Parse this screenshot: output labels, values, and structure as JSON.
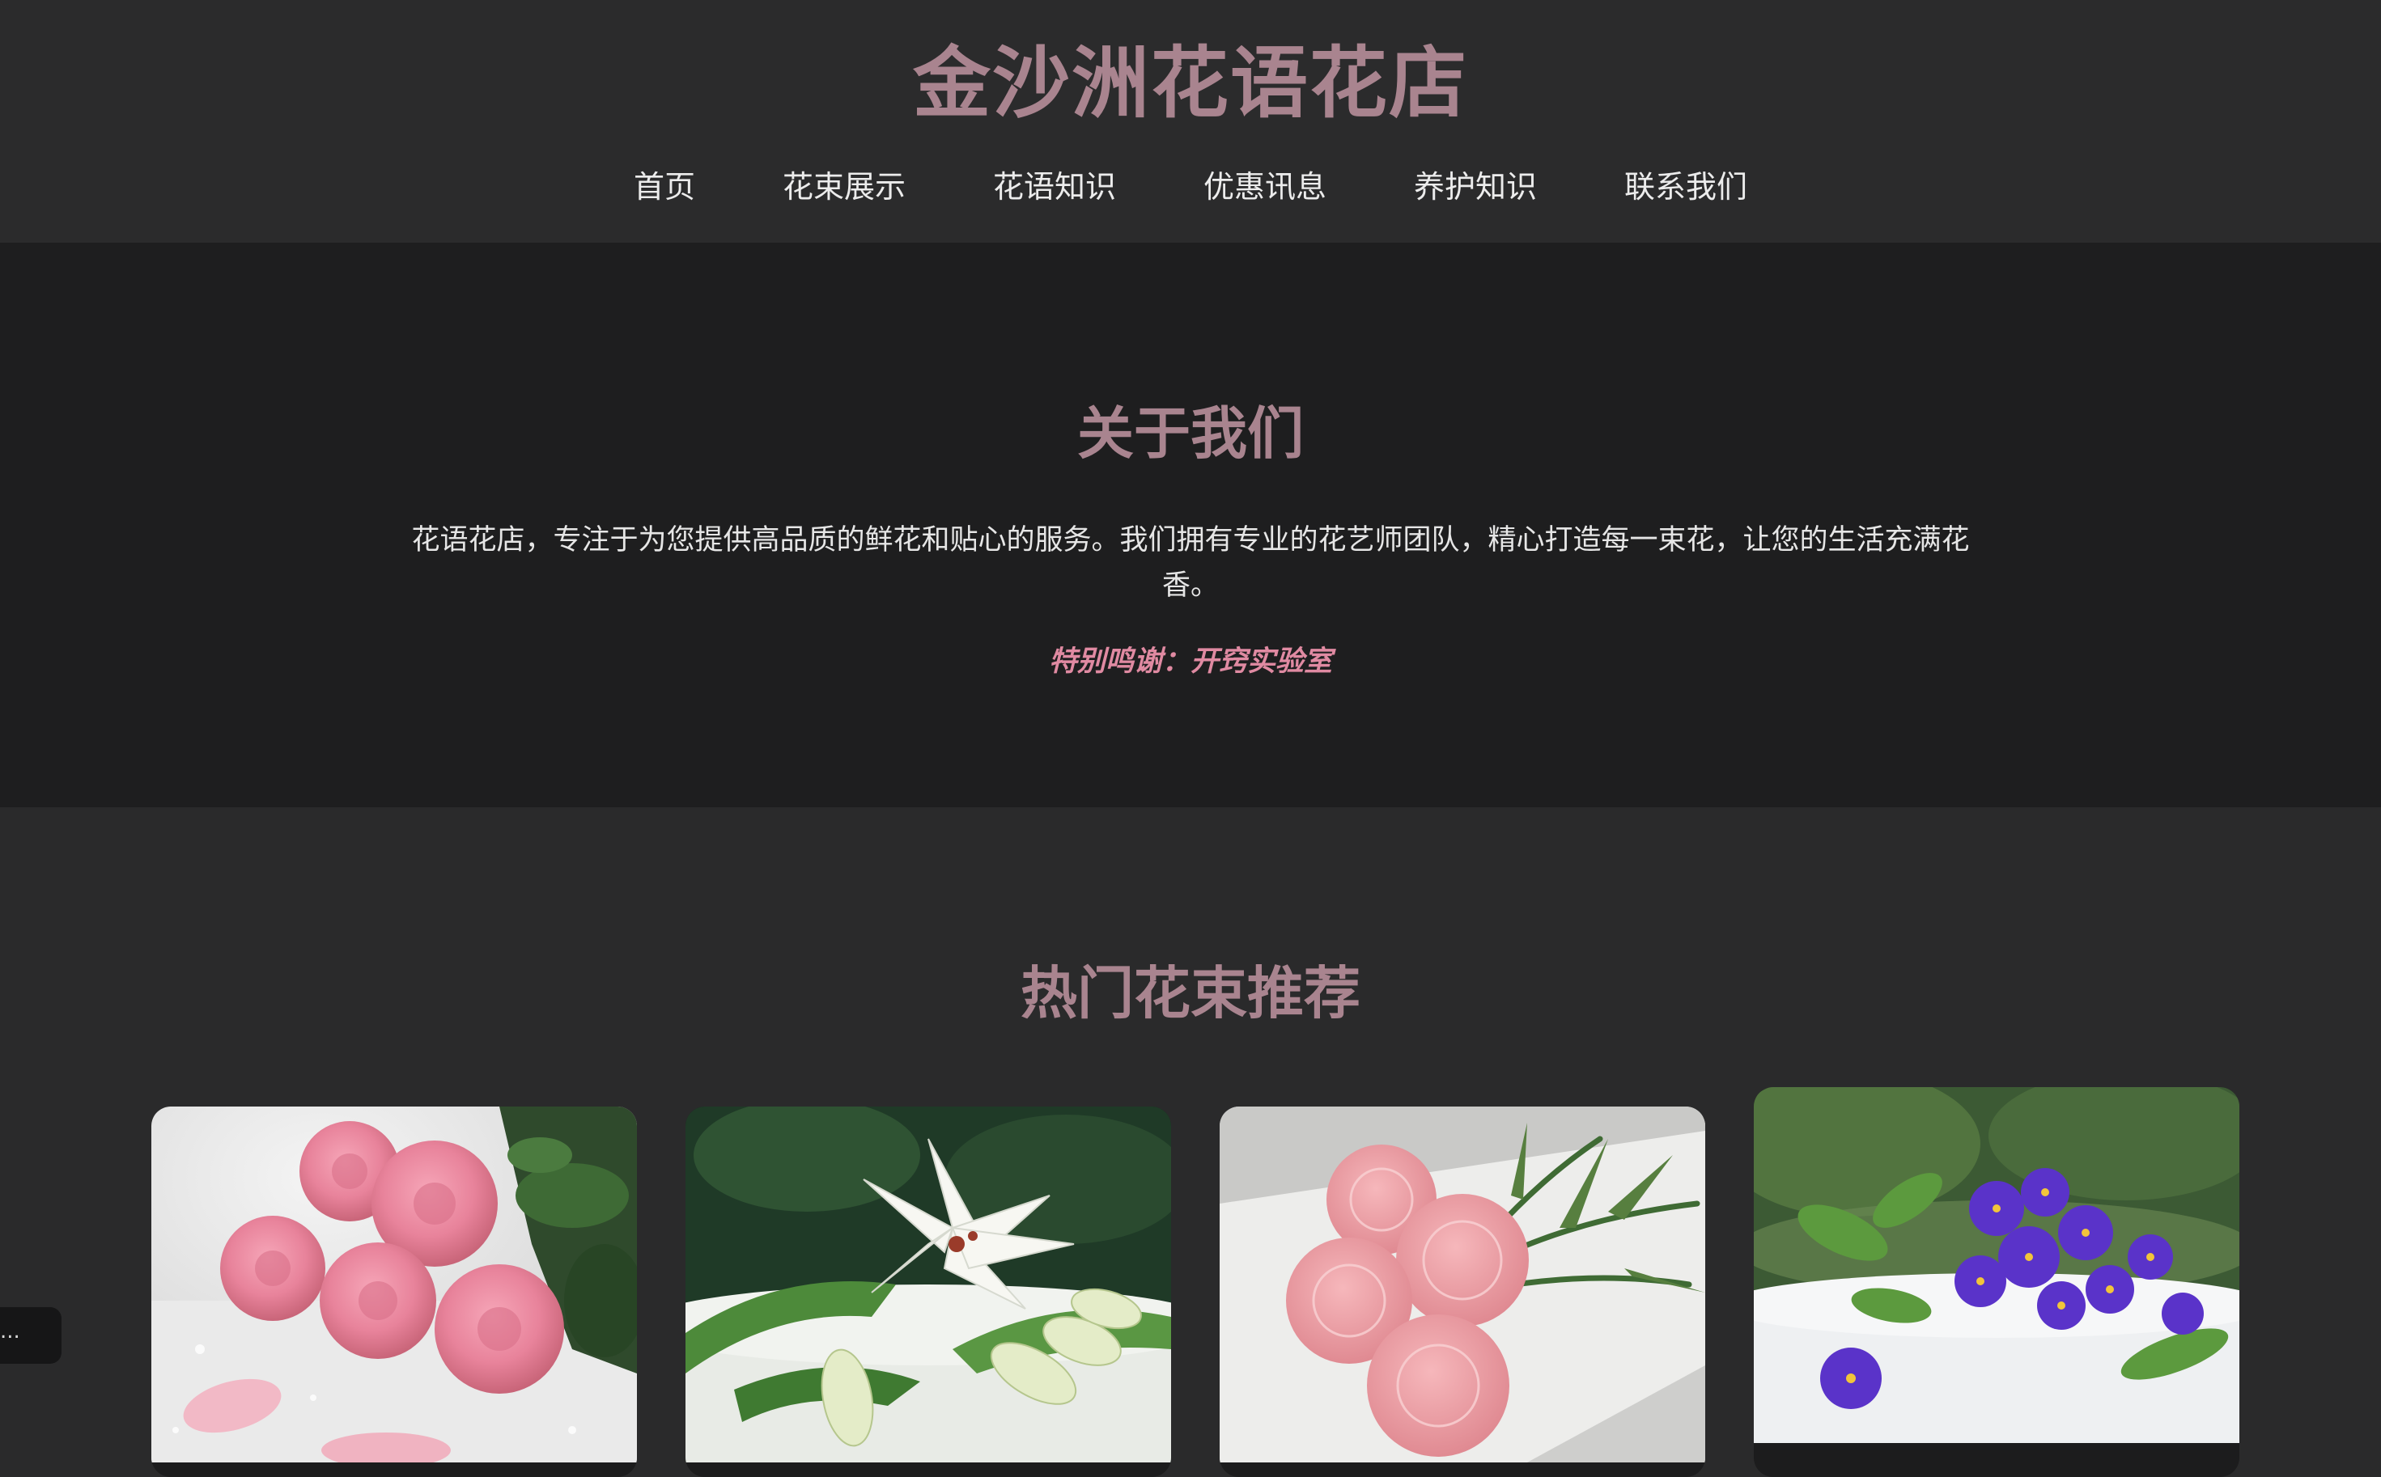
{
  "header": {
    "title": "金沙洲花语花店",
    "nav": [
      "首页",
      "花束展示",
      "花语知识",
      "优惠讯息",
      "养护知识",
      "联系我们"
    ]
  },
  "about": {
    "title": "关于我们",
    "description": "花语花店，专注于为您提供高品质的鲜花和贴心的服务。我们拥有专业的花艺师团队，精心打造每一束花，让您的生活充满花香。",
    "thanks": "特别鸣谢：开窍实验室"
  },
  "popular": {
    "title": "热门花束推荐",
    "cards": [
      {
        "alt": "pink roses"
      },
      {
        "alt": "white lilies"
      },
      {
        "alt": "pink carnations"
      },
      {
        "alt": "purple violets"
      }
    ]
  },
  "side_toast": {
    "text": "..."
  },
  "colors": {
    "accent_title": "#a9848f",
    "accent_pink": "#e08aa2",
    "header_bg": "#2b2b2c",
    "about_bg": "#1e1e1f",
    "page_bg": "#2a2a2b"
  }
}
